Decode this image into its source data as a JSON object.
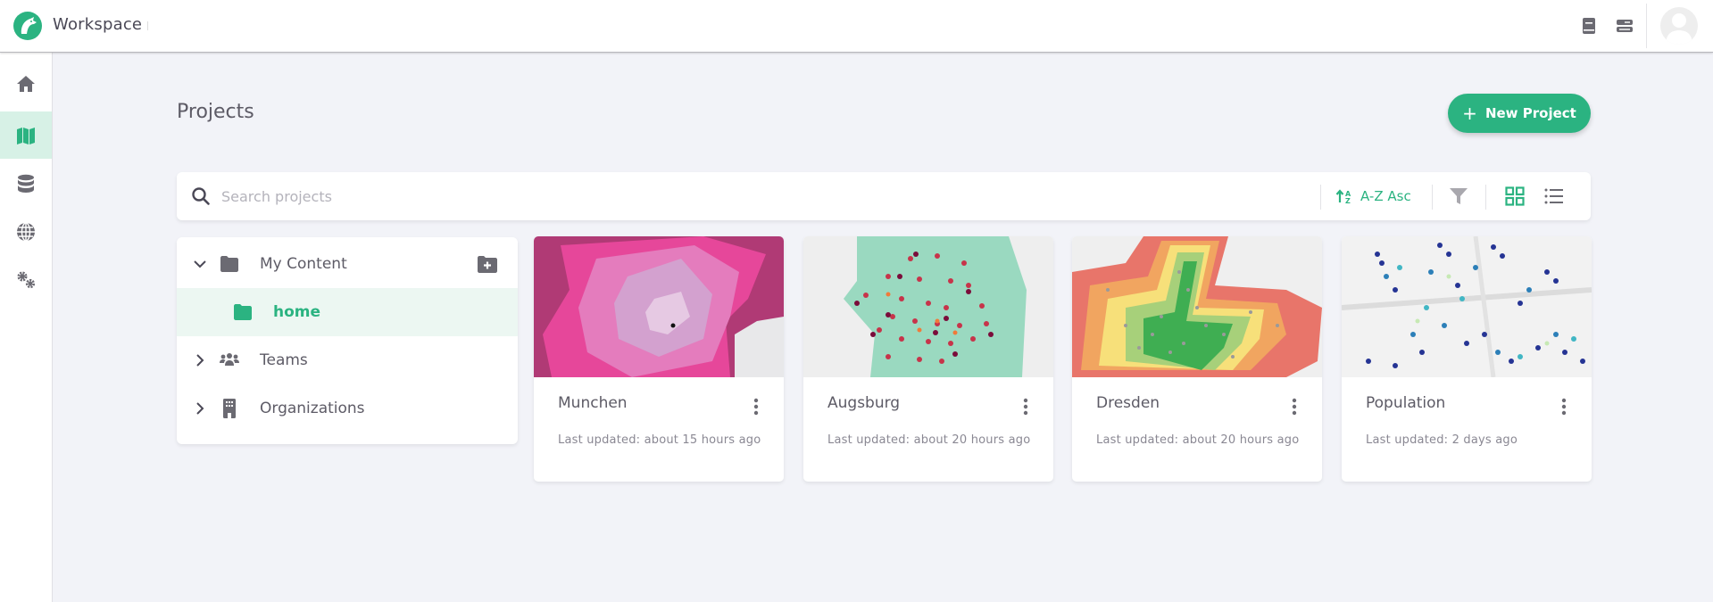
{
  "header": {
    "app_title": "Workspace",
    "icons": [
      "docs-book-icon",
      "server-stack-icon"
    ],
    "avatar": "user-avatar"
  },
  "colors": {
    "accent": "#2bb381",
    "accent_light": "#d7f1e6",
    "selected_row": "#ecf7f2",
    "icon_gray": "#6b6a72",
    "background": "#f2f3f8"
  },
  "rail": {
    "items": [
      {
        "name": "home",
        "icon": "home-icon",
        "active": false
      },
      {
        "name": "projects",
        "icon": "map-icon",
        "active": true
      },
      {
        "name": "datasets",
        "icon": "database-icon",
        "active": false
      },
      {
        "name": "explore",
        "icon": "globe-icon",
        "active": false
      },
      {
        "name": "settings",
        "icon": "gears-icon",
        "active": false
      }
    ]
  },
  "main": {
    "title": "Projects",
    "new_project_label": "New Project",
    "new_project_icon": "+",
    "search": {
      "placeholder": "Search projects",
      "value": ""
    },
    "sort_label": "A-Z Asc",
    "view_mode": "grid"
  },
  "tree": {
    "items": [
      {
        "label": "My Content",
        "icon": "folder-icon",
        "expanded": true,
        "selected": false
      },
      {
        "label": "home",
        "icon": "folder-icon",
        "selected": true
      },
      {
        "label": "Teams",
        "icon": "users-icon",
        "expanded": false,
        "selected": false
      },
      {
        "label": "Organizations",
        "icon": "building-icon",
        "expanded": false,
        "selected": false
      }
    ]
  },
  "projects": [
    {
      "title": "Munchen",
      "updated": "Last updated: about 15 hours ago"
    },
    {
      "title": "Augsburg",
      "updated": "Last updated: about 20 hours ago"
    },
    {
      "title": "Dresden",
      "updated": "Last updated: about 20 hours ago"
    },
    {
      "title": "Population",
      "updated": "Last updated: 2 days ago"
    }
  ]
}
